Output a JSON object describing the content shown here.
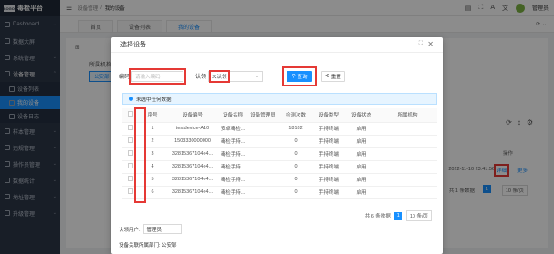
{
  "app": {
    "brand_logo_text": "LOGO",
    "brand_name": "毒检平台"
  },
  "sidebar": {
    "items": [
      {
        "label": "Dashboard"
      },
      {
        "label": "数据大屏"
      },
      {
        "label": "系统管理"
      },
      {
        "label": "设备管理"
      },
      {
        "label": "设备列表"
      },
      {
        "label": "我的设备"
      },
      {
        "label": "设备日志"
      },
      {
        "label": "样本管理"
      },
      {
        "label": "违规管理"
      },
      {
        "label": "操作员管理"
      },
      {
        "label": "数据统计"
      },
      {
        "label": "地址管理"
      },
      {
        "label": "升级管理"
      }
    ]
  },
  "topbar": {
    "breadcrumb": [
      "设备管理",
      "我的设备"
    ],
    "user_name": "管理员"
  },
  "tabs": [
    {
      "label": "首页"
    },
    {
      "label": "设备列表"
    },
    {
      "label": "我的设备"
    }
  ],
  "background": {
    "org_label": "所属机构",
    "org_chip": "公安部",
    "op_header": "操作",
    "date": "2022-11-10 23:41:56",
    "detail_link": "详细",
    "more_link": "更多",
    "total": "共 1 条数据",
    "page": "1",
    "page_size": "10 条/页"
  },
  "modal": {
    "title": "选择设备",
    "filter": {
      "code_label": "编码",
      "code_placeholder": "请输入编码",
      "status_label": "认领",
      "status_value": "未认领",
      "search_label": "查询",
      "reset_label": "重置"
    },
    "selected_info": "未选中任何数据",
    "table": {
      "headers": [
        "",
        "序号",
        "设备编号",
        "设备名称",
        "设备管理员",
        "检测次数",
        "设备类型",
        "设备状态",
        "所属机构"
      ],
      "rows": [
        [
          "1",
          "testdevice-A10",
          "安卓毒检...",
          "",
          "18182",
          "手持终端",
          "启用",
          ""
        ],
        [
          "2",
          "1503330000000",
          "毒检手持...",
          "",
          "0",
          "手持终端",
          "启用",
          ""
        ],
        [
          "3",
          "32815367104e4...",
          "毒检手持...",
          "",
          "0",
          "手持终端",
          "启用",
          ""
        ],
        [
          "4",
          "32815367104e4...",
          "毒检手持...",
          "",
          "0",
          "手持终端",
          "启用",
          ""
        ],
        [
          "5",
          "32815367104e4...",
          "毒检手持...",
          "",
          "0",
          "手持终端",
          "启用",
          ""
        ],
        [
          "6",
          "32815367104e4...",
          "毒检手持...",
          "",
          "0",
          "手持终端",
          "启用",
          ""
        ]
      ]
    },
    "pager": {
      "total": "共 6 条数据",
      "page": "1",
      "page_size": "10 条/页"
    },
    "auth_label": "认领用户:",
    "auth_value": "管理员",
    "dept_text": "设备关联所属部门: 公安部"
  },
  "colors": {
    "primary": "#1890ff",
    "highlight_red": "#e53935",
    "sidebar_bg": "#2d3748"
  }
}
